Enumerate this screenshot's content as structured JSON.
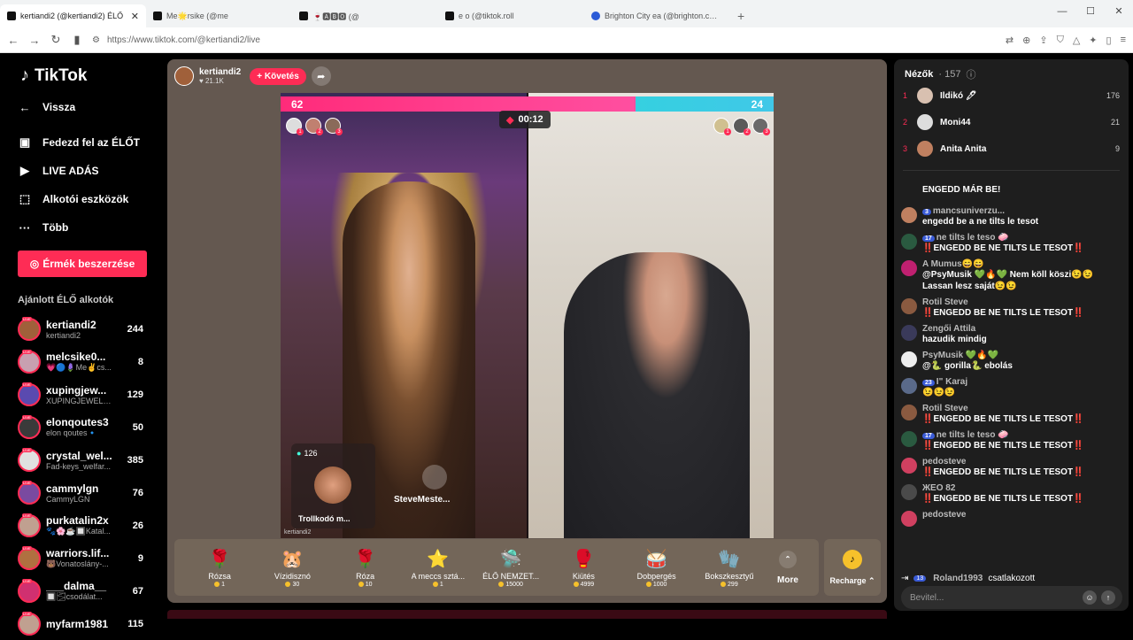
{
  "browser": {
    "tabs": [
      {
        "title": "kertiandi2 (@kertiandi2) ÉLŐ",
        "active": true
      },
      {
        "title": "Me🌟rsike (@me",
        "active": false
      },
      {
        "title": "🍷🅰🅱🅾 (@",
        "active": false
      },
      {
        "title": "e o (@tiktok.roll",
        "active": false
      },
      {
        "title": "Brighton City ea (@brighton.city) ÉLŐ",
        "active": false
      }
    ],
    "url": "https://www.tiktok.com/@kertiandi2/live"
  },
  "sidebar": {
    "brand": "TikTok",
    "back": "Vissza",
    "nav": [
      {
        "label": "Fedezd fel az ÉLŐT",
        "icon": "tv-icon"
      },
      {
        "label": "LIVE ADÁS",
        "icon": "camera-icon"
      },
      {
        "label": "Alkotói eszközök",
        "icon": "tools-icon"
      },
      {
        "label": "Több",
        "icon": "more-icon"
      }
    ],
    "coins_button": "Érmék beszerzése",
    "recommended_title": "Ajánlott ÉLŐ alkotók",
    "creators": [
      {
        "name": "kertiandi2",
        "sub": "kertiandi2",
        "count": "244",
        "color": "#a0603a"
      },
      {
        "name": "melcsike0...",
        "sub": "💗🔵🪻Me✌cs...",
        "count": "8",
        "color": "#c8a0b0"
      },
      {
        "name": "xupingjew...",
        "sub": "XUPINGJEWELR...",
        "count": "129",
        "color": "#5a4ab0"
      },
      {
        "name": "elonqoutes3",
        "sub": "elon qoutes🔹",
        "count": "50",
        "color": "#3a3a3a"
      },
      {
        "name": "crystal_wel...",
        "sub": "Fad-keys_welfar...",
        "count": "385",
        "color": "#e0e0e0"
      },
      {
        "name": "cammylgn",
        "sub": "CammyLGN",
        "count": "76",
        "color": "#7a4aa0"
      },
      {
        "name": "purkatalin2x",
        "sub": "🐾🌸☕🔲Katal...",
        "count": "26",
        "color": "#c0a090"
      },
      {
        "name": "warriors.lif...",
        "sub": "🐻Vonatoslány-...",
        "count": "9",
        "color": "#b07040"
      },
      {
        "name": "___dalma__",
        "sub": "🔲🌫csodálat...",
        "count": "67",
        "color": "#d03070"
      },
      {
        "name": "myfarm1981",
        "sub": "",
        "count": "115",
        "color": "#c0a090"
      }
    ]
  },
  "stream": {
    "host": "kertiandi2",
    "likes": "21.1K",
    "follow": "+ Követés",
    "score_left": "62",
    "score_right": "24",
    "score_left_fraction": 0.72,
    "timer": "00:12",
    "guest_count": "126",
    "guest_name": "Trollkodó m...",
    "slot2_name": "SteveMeste...",
    "watermark": "kertiandi2"
  },
  "gifts": [
    {
      "name": "Rózsa",
      "price": "1",
      "icon": "🌹"
    },
    {
      "name": "Vízidisznó",
      "price": "30",
      "icon": "🐹"
    },
    {
      "name": "Róza",
      "price": "10",
      "icon": "🌹"
    },
    {
      "name": "A meccs sztá...",
      "price": "1",
      "icon": "⭐"
    },
    {
      "name": "ÉLŐ NEMZET...",
      "price": "15000",
      "icon": "🛸"
    },
    {
      "name": "Kiütés",
      "price": "4999",
      "icon": "🥊"
    },
    {
      "name": "Dobpergés",
      "price": "1000",
      "icon": "🥁"
    },
    {
      "name": "Bokszkesztyű",
      "price": "299",
      "icon": "🧤"
    }
  ],
  "gift_more": "More",
  "recharge": "Recharge ⌃",
  "panel": {
    "viewers_title": "Nézők",
    "viewers_count": "· 157",
    "top": [
      {
        "rank": "1",
        "name": "Ildikó 🖊",
        "count": "176",
        "color": "#d8c0b0"
      },
      {
        "rank": "2",
        "name": "Moni44",
        "count": "21",
        "color": "#ddd"
      },
      {
        "rank": "3",
        "name": "Anita Anita",
        "count": "9",
        "color": "#c08060"
      }
    ],
    "chat": [
      {
        "name": "",
        "text": "ENGEDD MÁR BE!",
        "color": "#1e1e1e",
        "badge": ""
      },
      {
        "name": "mancsuniverzu...",
        "text": "engedd be a ne tilts le tesot",
        "color": "#c08060",
        "badge": "3"
      },
      {
        "name": "ne tilts le teso 🧼",
        "text": "‼️ENGEDD BE NE TILTS LE TESOT‼️",
        "color": "#2a5a40",
        "badge": "17"
      },
      {
        "name": "A Mumus😄😄",
        "text": "@PsyMusik 💚🔥💚 Nem köll köszi😉😉 Lassan lesz saját😉😉",
        "color": "#c02070",
        "badge": ""
      },
      {
        "name": "Rotil Steve",
        "text": "‼️ENGEDD BE NE TILTS LE TESOT‼️",
        "color": "#8a5a40",
        "badge": ""
      },
      {
        "name": "Zengői Attila",
        "text": "hazudik mindig",
        "color": "#3a3a5a",
        "badge": ""
      },
      {
        "name": "PsyMusik 💚🔥💚",
        "text": "@🐍 gorilla🐍 ebolás",
        "color": "#eee",
        "badge": ""
      },
      {
        "name": "I\" Karaj",
        "text": "😉😉😉",
        "color": "#5a6a8a",
        "badge": "23"
      },
      {
        "name": "Rotil Steve",
        "text": "‼️ENGEDD BE NE TILTS LE TESOT‼️",
        "color": "#8a5a40",
        "badge": ""
      },
      {
        "name": "ne tilts le teso 🧼",
        "text": "‼️ENGEDD BE NE TILTS LE TESOT‼️",
        "color": "#2a5a40",
        "badge": "17"
      },
      {
        "name": "pedosteve",
        "text": "‼️ENGEDD BE NE TILTS LE TESOT‼️",
        "color": "#d04060",
        "badge": ""
      },
      {
        "name": "ЖЕО 82",
        "text": "‼️ENGEDD BE NE TILTS LE TESOT‼️",
        "color": "#4a4a4a",
        "badge": ""
      },
      {
        "name": "pedosteve",
        "text": "",
        "color": "#d04060",
        "badge": ""
      }
    ],
    "joined_name": "Roland1993",
    "joined_text": "csatlakozott",
    "joined_badge": "13",
    "input_placeholder": "Bevitel..."
  }
}
